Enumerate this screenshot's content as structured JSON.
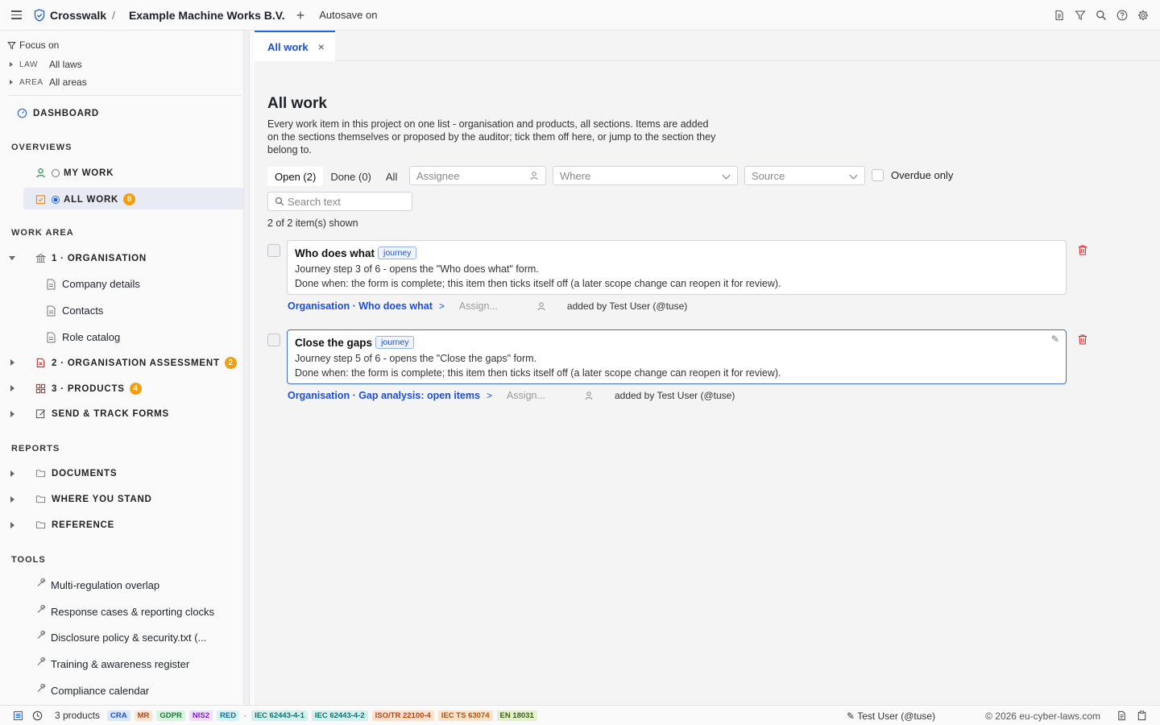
{
  "topbar": {
    "brand": "Crosswalk",
    "separator": "/",
    "project": "Example Machine Works B.V.",
    "add_symbol": "+",
    "autosave": "Autosave on",
    "icons": [
      "document-icon",
      "filter-icon",
      "search-icon",
      "help-icon",
      "settings-icon"
    ]
  },
  "sidebar": {
    "focus_title": "Focus on",
    "focus": [
      {
        "label": "LAW",
        "value": "All laws"
      },
      {
        "label": "AREA",
        "value": "All areas"
      }
    ],
    "dashboard": "DASHBOARD",
    "overviews_title": "OVERVIEWS",
    "my_work": "MY WORK",
    "all_work": "ALL WORK",
    "all_work_badge": "8",
    "work_area_title": "WORK AREA",
    "organisation": "1 · ORGANISATION",
    "org_children": [
      "Company details",
      "Contacts",
      "Role catalog"
    ],
    "org_assessment": "2 · ORGANISATION ASSESSMENT",
    "org_assessment_badge": "2",
    "products": "3 · PRODUCTS",
    "products_badge": "4",
    "send_forms": "SEND & TRACK FORMS",
    "reports_title": "REPORTS",
    "reports": [
      "DOCUMENTS",
      "WHERE YOU STAND",
      "REFERENCE"
    ],
    "tools_title": "TOOLS",
    "tools": [
      "Multi-regulation overlap",
      "Response cases & reporting clocks",
      "Disclosure policy & security.txt (...",
      "Training & awareness register",
      "Compliance calendar"
    ]
  },
  "main": {
    "tab_label": "All work",
    "tab_close": "×",
    "title": "All work",
    "description": "Every work item in this project on one list - organisation and products, all sections. Items are added on the sections themselves or proposed by the auditor; tick them off here, or jump to the section they belong to.",
    "segments": [
      "Open (2)",
      "Done (0)",
      "All"
    ],
    "assignee_placeholder": "Assignee",
    "where_placeholder": "Where",
    "source_placeholder": "Source",
    "overdue_label": "Overdue only",
    "search_placeholder": "Search text",
    "count_text": "2 of 2 item(s) shown",
    "items": [
      {
        "title": "Who does what",
        "tag": "journey",
        "line1": "Journey step 3 of 6 - opens the \"Who does what\" form.",
        "line2": "Done when: the form is complete; this item then ticks itself off (a later scope change can reopen it for review).",
        "link": "Organisation · Who does what",
        "assign": "Assign...",
        "added": "added by Test User (@tuse)"
      },
      {
        "title": "Close the gaps",
        "tag": "journey",
        "line1": "Journey step 5 of 6 - opens the \"Close the gaps\" form.",
        "line2": "Done when: the form is complete; this item then ticks itself off (a later scope change can reopen it for review).",
        "link": "Organisation · Gap analysis: open items",
        "assign": "Assign...",
        "added": "added by Test User (@tuse)"
      }
    ]
  },
  "statusbar": {
    "products": "3 products",
    "laws": [
      {
        "label": "CRA",
        "fg": "#1d4ed8",
        "bg": "#dbe7fb"
      },
      {
        "label": "MR",
        "fg": "#c2410c",
        "bg": "#fde6d3"
      },
      {
        "label": "GDPR",
        "fg": "#15803d",
        "bg": "#dcf3e2"
      },
      {
        "label": "NIS2",
        "fg": "#7e22ce",
        "bg": "#efe0fb"
      },
      {
        "label": "RED",
        "fg": "#0e7490",
        "bg": "#d8f1f6"
      }
    ],
    "dot": "·",
    "standards": [
      {
        "label": "IEC 62443-4-1",
        "fg": "#0f766e",
        "bg": "#d5efec"
      },
      {
        "label": "IEC 62443-4-2",
        "fg": "#0f766e",
        "bg": "#d5efec"
      },
      {
        "label": "ISO/TR 22100-4",
        "fg": "#c2410c",
        "bg": "#fde2cf"
      },
      {
        "label": "IEC TS 63074",
        "fg": "#b45309",
        "bg": "#fbe3cd"
      },
      {
        "label": "EN 18031",
        "fg": "#3f6212",
        "bg": "#e3efcf"
      }
    ],
    "user": "✎ Test User (@tuse)",
    "copyright": "© 2026 eu-cyber-laws.com"
  }
}
